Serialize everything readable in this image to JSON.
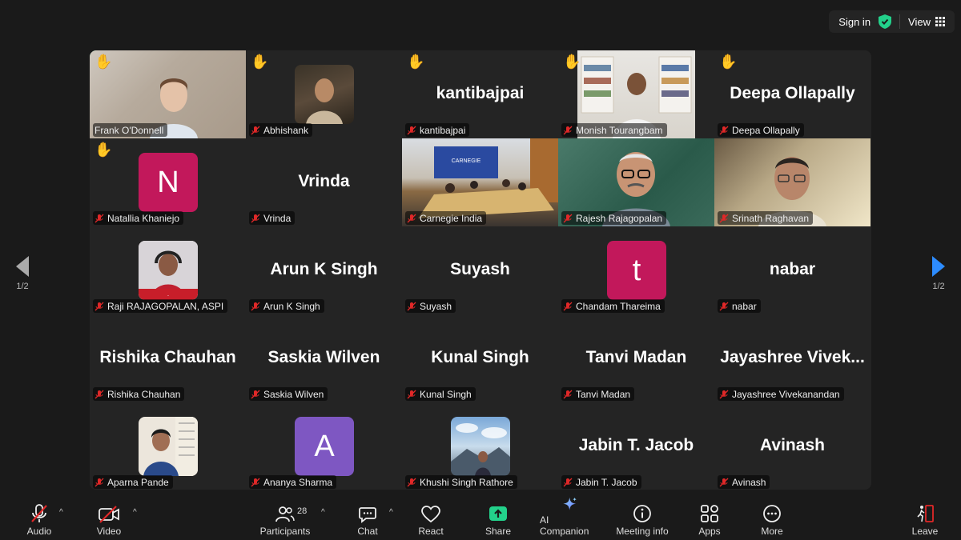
{
  "topbar": {
    "sign_in": "Sign in",
    "view": "View"
  },
  "nav": {
    "left_page": "1/2",
    "right_page": "1/2"
  },
  "tiles": [
    {
      "id": "t1",
      "name": "Frank O'Donnell",
      "hand": true,
      "type": "video"
    },
    {
      "id": "t2",
      "name": "Abhishank",
      "hand": true,
      "type": "photo"
    },
    {
      "id": "t3",
      "name": "kantibajpai",
      "display": "kantibajpai",
      "hand": true,
      "type": "name"
    },
    {
      "id": "t4",
      "name": "Monish Tourangbam",
      "hand": true,
      "type": "video"
    },
    {
      "id": "t5",
      "name": "Deepa Ollapally",
      "display": "Deepa Ollapally",
      "hand": true,
      "type": "name"
    },
    {
      "id": "t6",
      "name": "Natallia Khaniejo",
      "hand": true,
      "type": "avatar",
      "letter": "N",
      "color": "#c2185b"
    },
    {
      "id": "t7",
      "name": "Vrinda",
      "display": "Vrinda",
      "type": "name"
    },
    {
      "id": "t8",
      "name": "Carnegie India",
      "type": "video"
    },
    {
      "id": "t9",
      "name": "Rajesh Rajagopalan",
      "type": "video"
    },
    {
      "id": "t10",
      "name": "Srinath Raghavan",
      "type": "video"
    },
    {
      "id": "t11",
      "name": "Raji RAJAGOPALAN, ASPI",
      "type": "photo"
    },
    {
      "id": "t12",
      "name": "Arun K Singh",
      "display": "Arun K Singh",
      "type": "name"
    },
    {
      "id": "t13",
      "name": "Suyash",
      "display": "Suyash",
      "type": "name"
    },
    {
      "id": "t14",
      "name": "Chandam Thareima",
      "type": "avatar",
      "letter": "t",
      "color": "#c2185b"
    },
    {
      "id": "t15",
      "name": "nabar",
      "display": "nabar",
      "type": "name"
    },
    {
      "id": "t16",
      "name": "Rishika Chauhan",
      "display": "Rishika Chauhan",
      "type": "name"
    },
    {
      "id": "t17",
      "name": "Saskia Wilven",
      "display": "Saskia Wilven",
      "type": "name"
    },
    {
      "id": "t18",
      "name": "Kunal Singh",
      "display": "Kunal Singh",
      "type": "name"
    },
    {
      "id": "t19",
      "name": "Tanvi Madan",
      "display": "Tanvi Madan",
      "type": "name"
    },
    {
      "id": "t20",
      "name": "Jayashree Vivekanandan",
      "display": "Jayashree  Vivek...",
      "type": "name"
    },
    {
      "id": "t21",
      "name": "Aparna Pande",
      "type": "photo"
    },
    {
      "id": "t22",
      "name": "Ananya Sharma",
      "type": "avatar",
      "letter": "A",
      "color": "#7e57c2"
    },
    {
      "id": "t23",
      "name": "Khushi Singh Rathore",
      "type": "photo"
    },
    {
      "id": "t24",
      "name": "Jabin T. Jacob",
      "display": "Jabin T. Jacob",
      "type": "name"
    },
    {
      "id": "t25",
      "name": "Avinash",
      "display": "Avinash",
      "type": "name"
    }
  ],
  "toolbar": {
    "audio": "Audio",
    "video": "Video",
    "participants": "Participants",
    "participants_count": "28",
    "chat": "Chat",
    "react": "React",
    "share": "Share",
    "ai_companion": "AI Companion",
    "meeting_info": "Meeting info",
    "apps": "Apps",
    "more": "More",
    "leave": "Leave"
  },
  "colors": {
    "active_speaker": "#23d18b",
    "share": "#23d18b",
    "nav_arrow": "#2d8cff",
    "leave": "#e02828"
  }
}
